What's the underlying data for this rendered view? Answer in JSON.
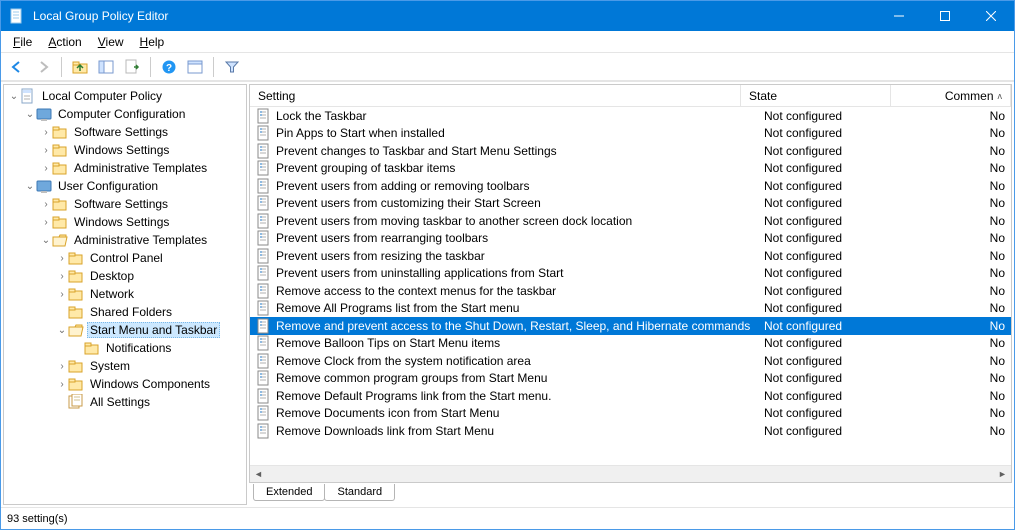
{
  "window": {
    "title": "Local Group Policy Editor"
  },
  "menu": {
    "file": "File",
    "action": "Action",
    "view": "View",
    "help": "Help"
  },
  "toolbar_icons": [
    "back",
    "forward",
    "up",
    "console",
    "export",
    "refresh",
    "help",
    "properties",
    "filter"
  ],
  "tree": {
    "root": "Local Computer Policy",
    "comp_conf": "Computer Configuration",
    "comp_soft": "Software Settings",
    "comp_win": "Windows Settings",
    "comp_admin": "Administrative Templates",
    "user_conf": "User Configuration",
    "user_soft": "Software Settings",
    "user_win": "Windows Settings",
    "user_admin": "Administrative Templates",
    "cp": "Control Panel",
    "desktop": "Desktop",
    "network": "Network",
    "shared": "Shared Folders",
    "startmenu": "Start Menu and Taskbar",
    "notifications": "Notifications",
    "system": "System",
    "wincomp": "Windows Components",
    "allsettings": "All Settings"
  },
  "columns": {
    "setting": "Setting",
    "state": "State",
    "comment": "Commen"
  },
  "state_label": "Not configured",
  "no_label": "No",
  "policies": [
    "Lock the Taskbar",
    "Pin Apps to Start when installed",
    "Prevent changes to Taskbar and Start Menu Settings",
    "Prevent grouping of taskbar items",
    "Prevent users from adding or removing toolbars",
    "Prevent users from customizing their Start Screen",
    "Prevent users from moving taskbar to another screen dock location",
    "Prevent users from rearranging toolbars",
    "Prevent users from resizing the taskbar",
    "Prevent users from uninstalling applications from Start",
    "Remove access to the context menus for the taskbar",
    "Remove All Programs list from the Start menu",
    "Remove and prevent access to the Shut Down, Restart, Sleep, and Hibernate commands",
    "Remove Balloon Tips on Start Menu items",
    "Remove Clock from the system notification area",
    "Remove common program groups from Start Menu",
    "Remove Default Programs link from the Start menu.",
    "Remove Documents icon from Start Menu",
    "Remove Downloads link from Start Menu"
  ],
  "selected_index": 12,
  "tabs": {
    "extended": "Extended",
    "standard": "Standard"
  },
  "status": "93 setting(s)",
  "sortmark": "ʌ"
}
